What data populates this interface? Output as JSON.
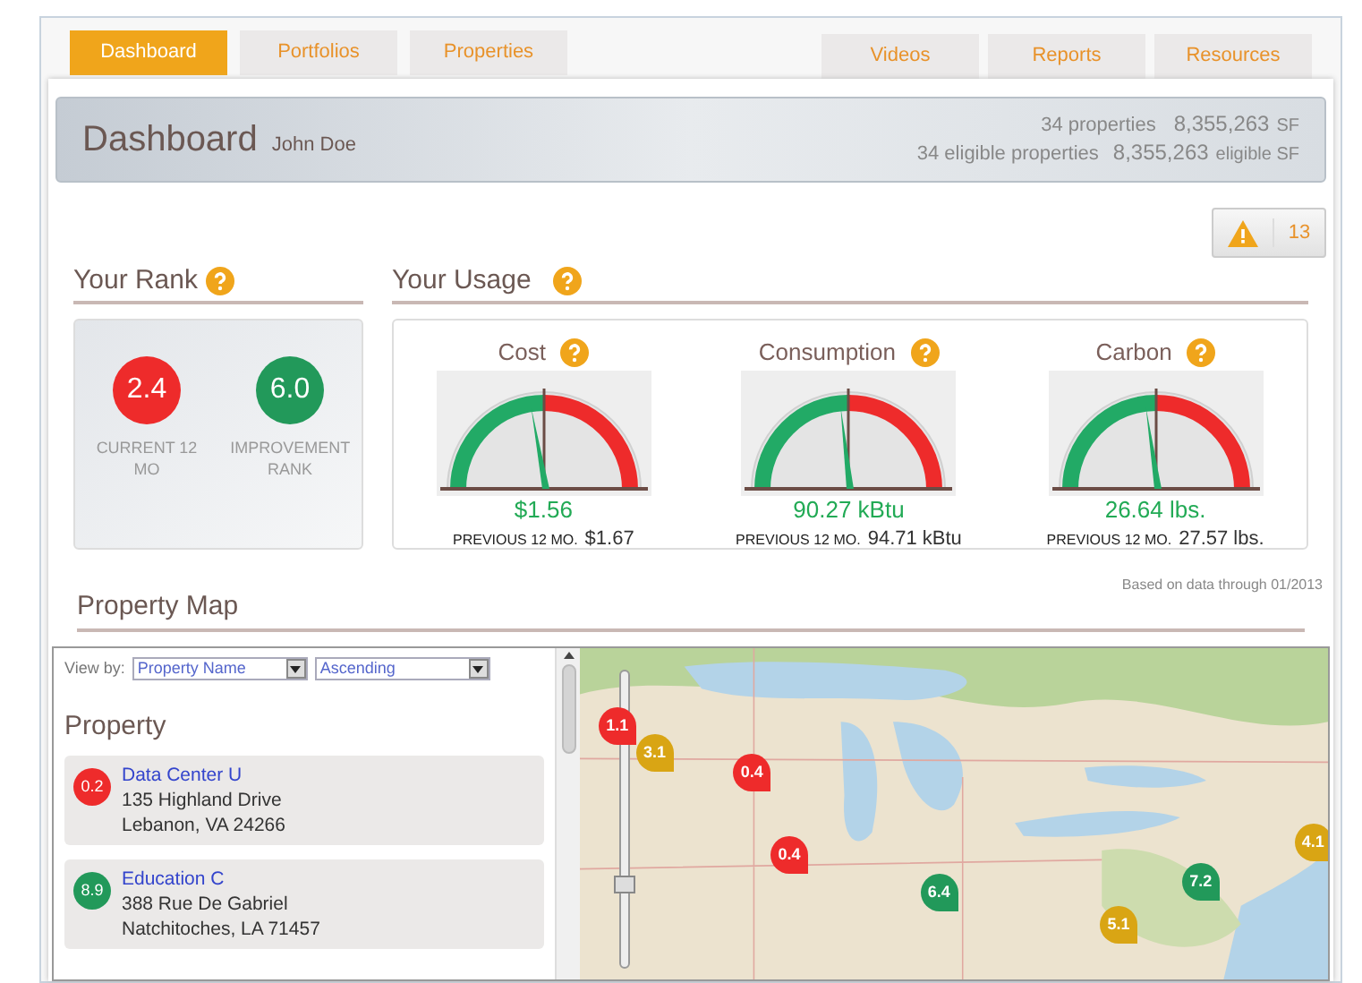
{
  "nav": {
    "left_tabs": [
      {
        "label": "Dashboard",
        "selected": true
      },
      {
        "label": "Portfolios",
        "selected": false
      },
      {
        "label": "Properties",
        "selected": false
      }
    ],
    "right_tabs": [
      {
        "label": "Videos",
        "selected": false
      },
      {
        "label": "Reports",
        "selected": false
      },
      {
        "label": "Resources",
        "selected": false
      }
    ]
  },
  "header": {
    "title": "Dashboard",
    "user": "John Doe",
    "properties_count": "34 properties",
    "properties_area": "8,355,263",
    "area_unit": "SF",
    "eligible_count": "34 eligible properties",
    "eligible_area": "8,355,263",
    "eligible_unit": "eligible SF"
  },
  "alerts": {
    "count": "13"
  },
  "rank": {
    "title": "Your Rank",
    "badges": [
      {
        "value": "2.4",
        "color": "#ee2b2b",
        "caption": "CURRENT 12 MO"
      },
      {
        "value": "6.0",
        "color": "#22995a",
        "caption": "IMPROVEMENT RANK"
      }
    ]
  },
  "usage": {
    "title": "Your Usage",
    "gauges": [
      {
        "label": "Cost",
        "value": "$1.56",
        "previous_label": "PREVIOUS 12 MO.",
        "previous_value": "$1.67",
        "level": 0.45
      },
      {
        "label": "Consumption",
        "value": "90.27 kBtu",
        "previous_label": "PREVIOUS 12 MO.",
        "previous_value": "94.71 kBtu",
        "level": 0.47
      },
      {
        "label": "Carbon",
        "value": "26.64 lbs.",
        "previous_label": "PREVIOUS 12 MO.",
        "previous_value": "27.57 lbs.",
        "level": 0.46
      }
    ],
    "footnote": "Based on data through 01/2013"
  },
  "property_map": {
    "title": "Property Map",
    "view_by_label": "View by:",
    "sort_field": "Property Name",
    "sort_order": "Ascending",
    "list_title": "Property",
    "properties": [
      {
        "score": "0.2",
        "color": "#ee2b2b",
        "name": "Data Center U",
        "street": "135 Highland Drive",
        "city": "Lebanon, VA 24266"
      },
      {
        "score": "8.9",
        "color": "#22995a",
        "name": "Education C",
        "street": "388 Rue De Gabriel",
        "city": "Natchitoches, LA 71457"
      }
    ],
    "map": {
      "kind": "picture",
      "zoom": {
        "level": 0.25
      },
      "markers": [
        {
          "label": "1.1",
          "color": "#ee2b2b"
        },
        {
          "label": "3.1",
          "color": "#d9a514"
        },
        {
          "label": "0.4",
          "color": "#ee2b2b"
        },
        {
          "label": "0.4",
          "color": "#ee2b2b"
        },
        {
          "label": "6.4",
          "color": "#22995a"
        },
        {
          "label": "7.2",
          "color": "#22995a"
        },
        {
          "label": "5.1",
          "color": "#d9a514"
        },
        {
          "label": "4.1",
          "color": "#d9a514"
        }
      ]
    }
  }
}
